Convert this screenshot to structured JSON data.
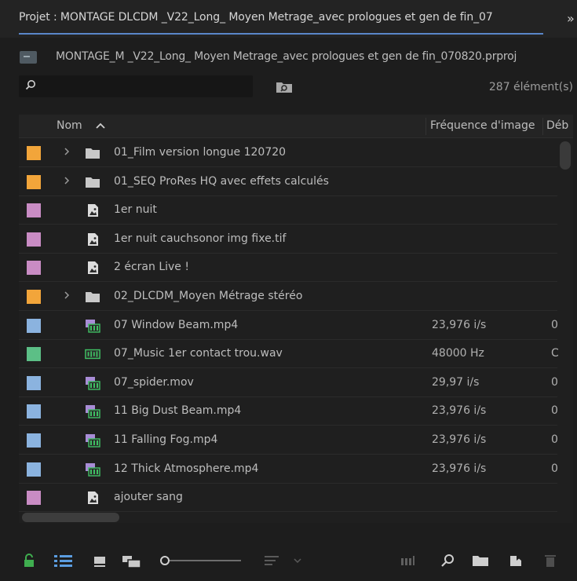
{
  "title": {
    "tab_label": "Projet : MONTAGE DLCDM _V22_Long_ Moyen Metrage_avec prologues et gen de fin_07",
    "more_chevron": "»"
  },
  "project": {
    "path": "MONTAGE_M _V22_Long_ Moyen Metrage_avec prologues et gen de fin_070820.prproj",
    "icon": "project-folder-icon"
  },
  "search": {
    "value": "",
    "placeholder": "",
    "count": "287 élément(s)"
  },
  "columns": {
    "name": "Nom",
    "frame_rate": "Fréquence d'image",
    "start": "Déb"
  },
  "colors": {
    "orange_label": "#f2a53a",
    "violet_label": "#c98cc4",
    "blue_label": "#8bb3df",
    "green_label": "#5cbf86",
    "accent_blue": "#5a86c9",
    "lock_green": "#3fae4f",
    "list_view_blue": "#5b9de0"
  },
  "items": [
    {
      "label_color": "#f2a53a",
      "type": "bin",
      "expandable": true,
      "name": "01_Film version longue 120720",
      "fps": "",
      "start": ""
    },
    {
      "label_color": "#f2a53a",
      "type": "bin",
      "expandable": true,
      "name": "01_SEQ  ProRes HQ avec effets calculés",
      "fps": "",
      "start": ""
    },
    {
      "label_color": "#c98cc4",
      "type": "still",
      "expandable": false,
      "name": "1er nuit",
      "fps": "",
      "start": ""
    },
    {
      "label_color": "#c98cc4",
      "type": "still",
      "expandable": false,
      "name": "1er nuit cauchsonor img fixe.tif",
      "fps": "",
      "start": ""
    },
    {
      "label_color": "#c98cc4",
      "type": "still",
      "expandable": false,
      "name": "2 écran Live !",
      "fps": "",
      "start": ""
    },
    {
      "label_color": "#f2a53a",
      "type": "bin",
      "expandable": true,
      "name": "02_DLCDM_Moyen Métrage stéréo",
      "fps": "",
      "start": ""
    },
    {
      "label_color": "#8bb3df",
      "type": "video",
      "expandable": false,
      "name": "07 Window Beam.mp4",
      "fps": "23,976 i/s",
      "start": "0"
    },
    {
      "label_color": "#5cbf86",
      "type": "audio",
      "expandable": false,
      "name": "07_Music 1er contact trou.wav",
      "fps": "48000  Hz",
      "start": "C"
    },
    {
      "label_color": "#8bb3df",
      "type": "video",
      "expandable": false,
      "name": "07_spider.mov",
      "fps": "29,97 i/s",
      "start": "0"
    },
    {
      "label_color": "#8bb3df",
      "type": "video",
      "expandable": false,
      "name": "11 Big Dust Beam.mp4",
      "fps": "23,976 i/s",
      "start": "0"
    },
    {
      "label_color": "#8bb3df",
      "type": "video",
      "expandable": false,
      "name": "11 Falling Fog.mp4",
      "fps": "23,976 i/s",
      "start": "0"
    },
    {
      "label_color": "#8bb3df",
      "type": "video",
      "expandable": false,
      "name": "12 Thick Atmosphere.mp4",
      "fps": "23,976 i/s",
      "start": "0"
    },
    {
      "label_color": "#c98cc4",
      "type": "still",
      "expandable": false,
      "name": "ajouter sang",
      "fps": "",
      "start": ""
    }
  ],
  "toolbar": {
    "icons": [
      "lock-icon",
      "list-view-icon",
      "icon-view-icon",
      "freeform-view-icon",
      "zoom-slider",
      "sort-icon",
      "sort-dropdown-icon",
      "automate-sequence-icon",
      "find-icon",
      "new-bin-icon",
      "new-item-icon",
      "clear-icon"
    ],
    "zoom_level": 0
  }
}
